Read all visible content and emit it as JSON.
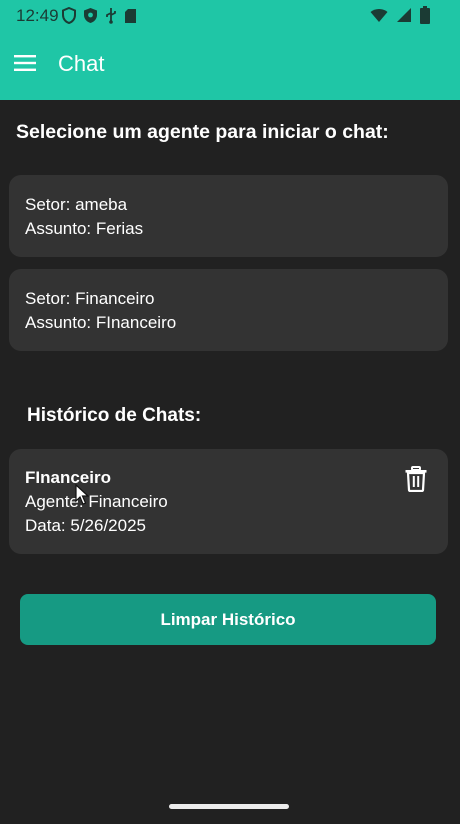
{
  "status_bar": {
    "time": "12:49",
    "left_icons": [
      "shield-outline-icon",
      "shield-lock-icon",
      "usb-icon",
      "sd-card-icon"
    ],
    "right_icons": [
      "wifi-icon",
      "signal-icon",
      "battery-icon"
    ]
  },
  "app_bar": {
    "title": "Chat",
    "menu_icon": "hamburger-menu-icon"
  },
  "agents": {
    "heading": "Selecione um agente para iniciar o chat:",
    "items": [
      {
        "sector": "Setor: ameba",
        "subject": "Assunto: Ferias"
      },
      {
        "sector": "Setor: Financeiro",
        "subject": "Assunto: FInanceiro"
      }
    ]
  },
  "history": {
    "heading": "Histórico de Chats:",
    "items": [
      {
        "name": "FInanceiro",
        "agent": "Agente: Financeiro",
        "date": "Data: 5/26/2025",
        "delete_icon": "trash-icon"
      }
    ],
    "clear_button_label": "Limpar Histórico"
  },
  "colors": {
    "app_bar": "#1fc6a6",
    "background": "#212121",
    "card": "#333333",
    "button": "#169a83",
    "text": "#ffffff"
  }
}
